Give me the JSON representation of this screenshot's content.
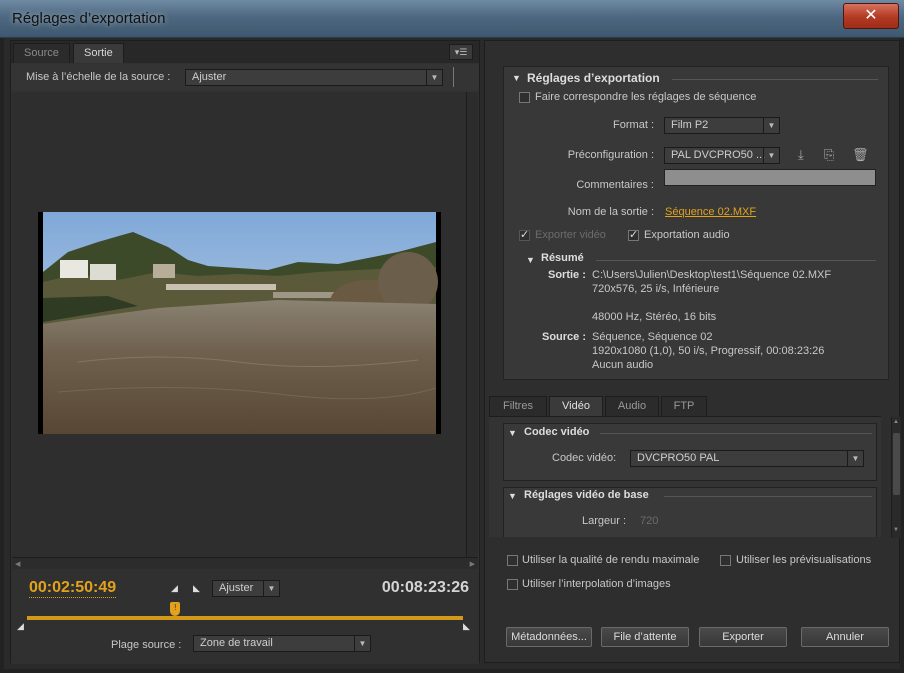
{
  "window": {
    "title": "Réglages d’exportation",
    "close_icon": "close-x"
  },
  "left_panel": {
    "tabs": [
      {
        "label": "Source"
      },
      {
        "label": "Sortie"
      }
    ],
    "active_tab": "Sortie",
    "scale_label": "Mise à l’échelle de la source :",
    "scale_value": "Ajuster",
    "timecode_in": "00:02:50:49",
    "timecode_out": "00:08:23:26",
    "zoom_value": "Ajuster",
    "playhead_fraction": 0.34,
    "range_label": "Plage source :",
    "range_value": "Zone de travail"
  },
  "export_settings": {
    "title": "Réglages d’exportation",
    "match_sequence_label": "Faire correspondre les réglages de séquence",
    "match_sequence_checked": false,
    "format_label": "Format :",
    "format_value": "Film P2",
    "preset_label": "Préconfiguration :",
    "preset_value": "PAL DVCPRO50 ...",
    "comments_label": "Commentaires :",
    "comments_value": "",
    "output_name_label": "Nom de la sortie :",
    "output_name_value": "Séquence 02.MXF",
    "export_video_label": "Exporter vidéo",
    "export_video_checked": true,
    "export_audio_label": "Exportation audio",
    "export_audio_checked": true,
    "summary": {
      "title": "Résumé",
      "output_label": "Sortie :",
      "output_lines": [
        "C:\\Users\\Julien\\Desktop\\test1\\Séquence 02.MXF",
        "720x576, 25 i/s, Inférieure",
        "",
        "48000 Hz, Stéréo, 16 bits"
      ],
      "source_label": "Source :",
      "source_lines": [
        "Séquence, Séquence 02",
        "1920x1080 (1,0), 50  i/s, Progressif, 00:08:23:26",
        "Aucun audio"
      ]
    }
  },
  "settings_tabs": [
    {
      "label": "Filtres"
    },
    {
      "label": "Vidéo"
    },
    {
      "label": "Audio"
    },
    {
      "label": "FTP"
    }
  ],
  "active_settings_tab": "Vidéo",
  "video": {
    "codec_section_title": "Codec vidéo",
    "codec_label": "Codec vidéo:",
    "codec_value": "DVCPRO50 PAL",
    "basic_section_title": "Réglages vidéo de base",
    "width_label": "Largeur :",
    "width_value": "720"
  },
  "options": {
    "max_render_quality": "Utiliser la qualité de rendu maximale",
    "use_previews": "Utiliser les prévisualisations",
    "frame_blending": "Utiliser l’interpolation d’images"
  },
  "buttons": {
    "metadata": "Métadonnées...",
    "queue": "File d’attente",
    "export": "Exporter",
    "cancel": "Annuler"
  }
}
